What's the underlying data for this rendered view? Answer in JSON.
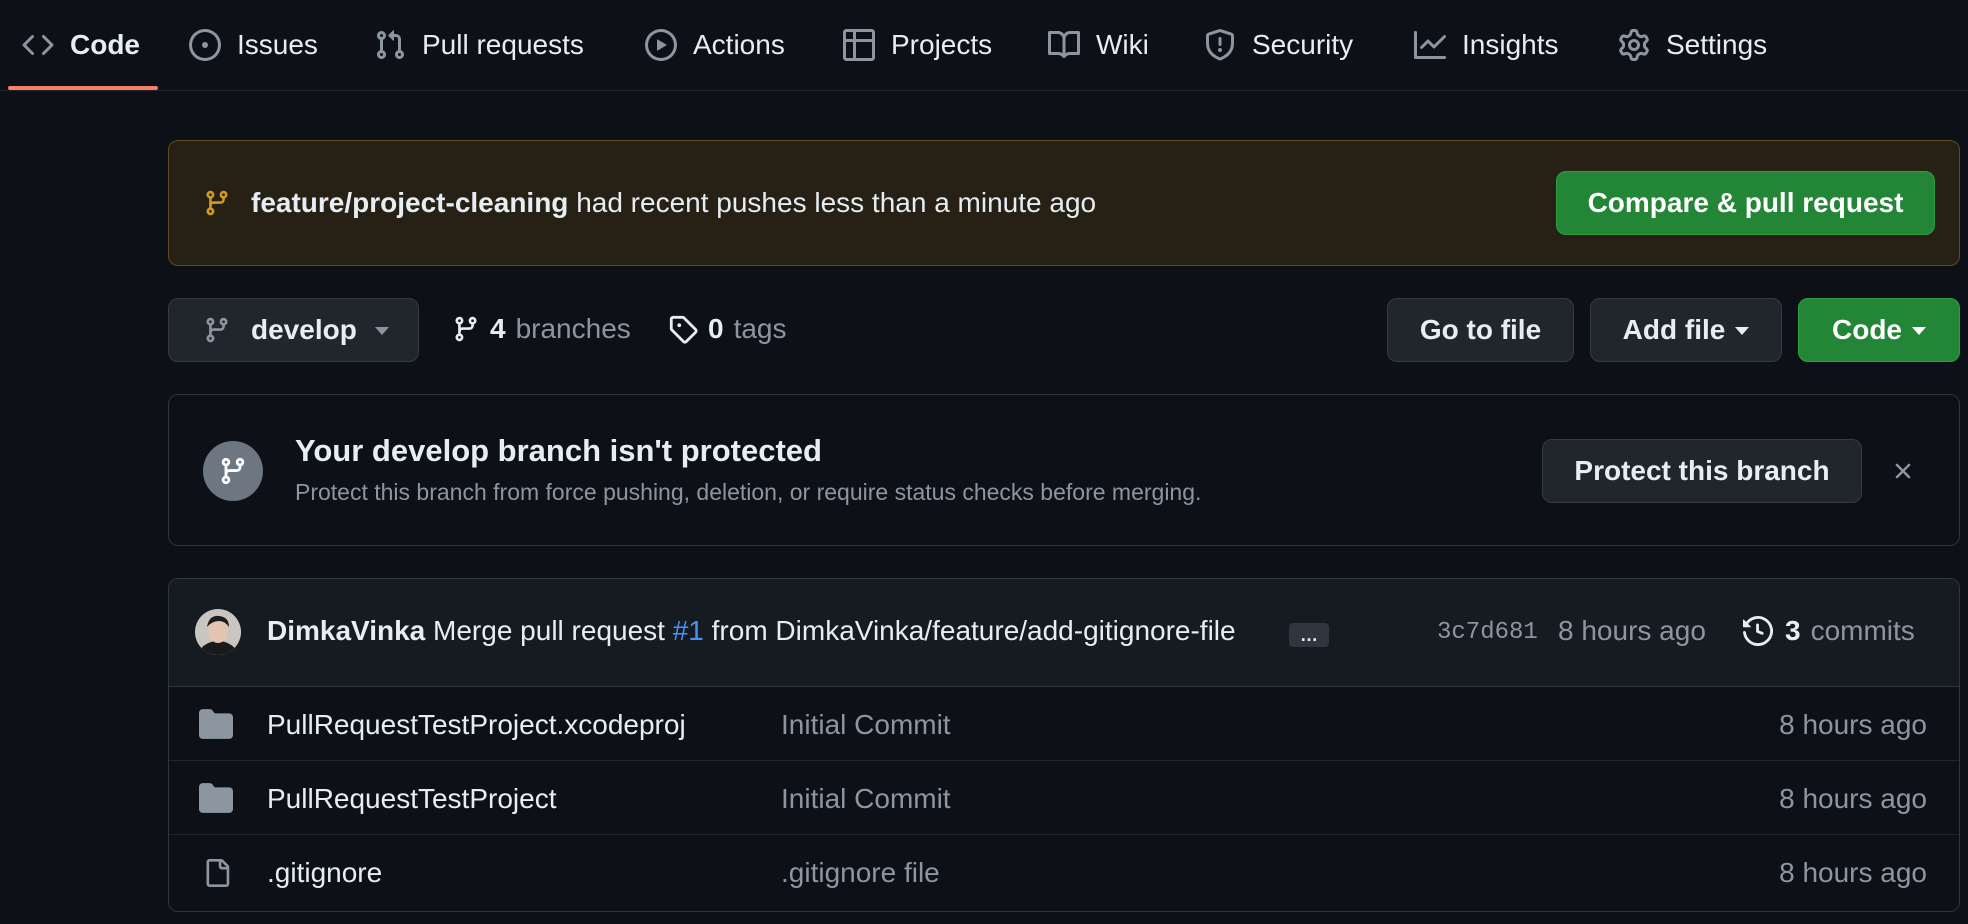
{
  "nav": {
    "tabs": [
      {
        "label": "Code",
        "icon": "code-icon",
        "selected": true
      },
      {
        "label": "Issues",
        "icon": "issue-opened-icon"
      },
      {
        "label": "Pull requests",
        "icon": "git-pull-request-icon"
      },
      {
        "label": "Actions",
        "icon": "play-icon"
      },
      {
        "label": "Projects",
        "icon": "table-icon"
      },
      {
        "label": "Wiki",
        "icon": "book-icon"
      },
      {
        "label": "Security",
        "icon": "shield-icon"
      },
      {
        "label": "Insights",
        "icon": "graph-icon"
      },
      {
        "label": "Settings",
        "icon": "gear-icon"
      }
    ]
  },
  "push_banner": {
    "branch": "feature/project-cleaning",
    "text": "had recent pushes less than a minute ago",
    "button": "Compare & pull request"
  },
  "branch_bar": {
    "current_branch": "develop",
    "branch_count": "4",
    "branch_label": "branches",
    "tag_count": "0",
    "tag_label": "tags",
    "go_to_file": "Go to file",
    "add_file": "Add file",
    "code": "Code"
  },
  "protect": {
    "title": "Your develop branch isn't protected",
    "description": "Protect this branch from force pushing, deletion, or require status checks before merging.",
    "button": "Protect this branch"
  },
  "latest_commit": {
    "author": "DimkaVinka",
    "message_prefix": "Merge pull request",
    "pr_number": "#1",
    "message_suffix": "from DimkaVinka/feature/add-gitignore-file",
    "ellipsis": "…",
    "sha": "3c7d681",
    "time": "8 hours ago",
    "commit_count": "3",
    "commit_label": "commits"
  },
  "files": [
    {
      "name": "PullRequestTestProject.xcodeproj",
      "type": "folder",
      "message": "Initial Commit",
      "age": "8 hours ago"
    },
    {
      "name": "PullRequestTestProject",
      "type": "folder",
      "message": "Initial Commit",
      "age": "8 hours ago"
    },
    {
      "name": ".gitignore",
      "type": "file",
      "message": ".gitignore file",
      "age": "8 hours ago"
    }
  ],
  "colors": {
    "background": "#0d1117",
    "accent_underline": "#f78166",
    "green_button": "#238636",
    "banner_bg": "#272115",
    "banner_icon": "#d29922",
    "link": "#4493f8"
  }
}
